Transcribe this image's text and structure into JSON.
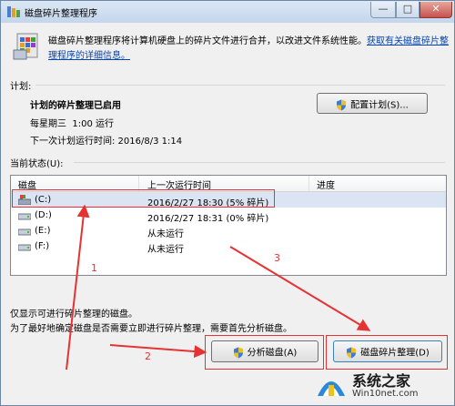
{
  "window": {
    "title": "磁盘碎片整理程序",
    "caption": {
      "minimize": "—",
      "maximize": "□",
      "close": "✕"
    }
  },
  "description": {
    "text": "磁盘碎片整理程序将计算机硬盘上的碎片文件进行合并，以改进文件系统性能。",
    "link": "获取有关磁盘碎片整理程序的详细信息。"
  },
  "schedule": {
    "group_label": "计划:",
    "status": "计划的碎片整理已启用",
    "frequency_label": "每星期三",
    "frequency_time": "1:00 运行",
    "next_run": "下一次计划运行时间: 2016/8/3 1:14",
    "configure_button": "配置计划(S)..."
  },
  "status": {
    "group_label": "当前状态(U):",
    "columns": [
      "磁盘",
      "上一次运行时间",
      "进度"
    ],
    "rows": [
      {
        "disk": "(C:)",
        "last_run": "2016/2/27 18:30 (5% 碎片)",
        "progress": "",
        "icon": "system-drive-icon"
      },
      {
        "disk": "(D:)",
        "last_run": "2016/2/27 18:31 (0% 碎片)",
        "progress": "",
        "icon": "hard-drive-icon"
      },
      {
        "disk": "(E:)",
        "last_run": "从未运行",
        "progress": "",
        "icon": "hard-drive-icon"
      },
      {
        "disk": "(F:)",
        "last_run": "从未运行",
        "progress": "",
        "icon": "hard-drive-icon"
      }
    ]
  },
  "notes": {
    "line1": "仅显示可进行碎片整理的磁盘。",
    "line2": "为了最好地确定磁盘是否需要立即进行碎片整理，需要首先分析磁盘。"
  },
  "buttons": {
    "analyze": "分析磁盘(A)",
    "defragment": "磁盘碎片整理(D)"
  },
  "annotations": {
    "n1": "1",
    "n2": "2",
    "n3": "3"
  },
  "watermark": {
    "text": "系统之家",
    "url": "Win10net.com"
  },
  "colors": {
    "annotation": "#e53333",
    "selection": "#dbe4f2",
    "link": "#0645ad"
  }
}
